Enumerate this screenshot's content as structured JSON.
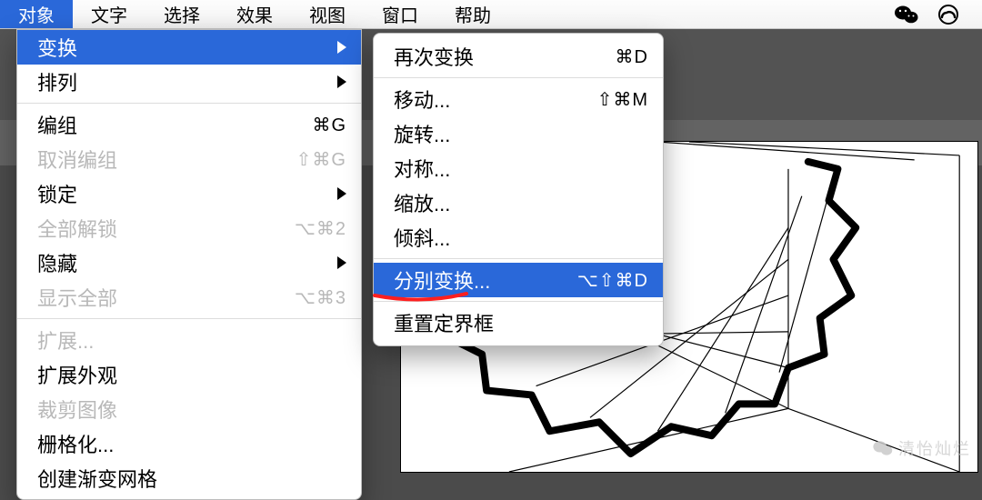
{
  "menubar": {
    "items": [
      "对象",
      "文字",
      "选择",
      "效果",
      "视图",
      "窗口",
      "帮助"
    ],
    "selected": 0
  },
  "menu1": [
    {
      "label": "变换",
      "shortcut": "",
      "arrow": true,
      "disabled": false,
      "selected": true
    },
    {
      "label": "排列",
      "shortcut": "",
      "arrow": true,
      "disabled": false
    },
    {
      "sep": true
    },
    {
      "label": "编组",
      "shortcut": "⌘G",
      "arrow": false,
      "disabled": false
    },
    {
      "label": "取消编组",
      "shortcut": "⇧⌘G",
      "arrow": false,
      "disabled": true
    },
    {
      "label": "锁定",
      "shortcut": "",
      "arrow": true,
      "disabled": false
    },
    {
      "label": "全部解锁",
      "shortcut": "⌥⌘2",
      "arrow": false,
      "disabled": true
    },
    {
      "label": "隐藏",
      "shortcut": "",
      "arrow": true,
      "disabled": false
    },
    {
      "label": "显示全部",
      "shortcut": "⌥⌘3",
      "arrow": false,
      "disabled": true
    },
    {
      "sep": true
    },
    {
      "label": "扩展...",
      "shortcut": "",
      "arrow": false,
      "disabled": true
    },
    {
      "label": "扩展外观",
      "shortcut": "",
      "arrow": false,
      "disabled": false
    },
    {
      "label": "裁剪图像",
      "shortcut": "",
      "arrow": false,
      "disabled": true
    },
    {
      "label": "栅格化...",
      "shortcut": "",
      "arrow": false,
      "disabled": false
    },
    {
      "label": "创建渐变网格",
      "shortcut": "",
      "arrow": false,
      "disabled": false
    }
  ],
  "menu2": [
    {
      "label": "再次变换",
      "shortcut": "⌘D"
    },
    {
      "sep": true
    },
    {
      "label": "移动...",
      "shortcut": "⇧⌘M"
    },
    {
      "label": "旋转..."
    },
    {
      "label": "对称..."
    },
    {
      "label": "缩放..."
    },
    {
      "label": "倾斜..."
    },
    {
      "sep": true
    },
    {
      "label": "分别变换...",
      "shortcut": "⌥⇧⌘D",
      "selected": true
    },
    {
      "sep": true
    },
    {
      "label": "重置定界框"
    }
  ],
  "watermark": "清怡灿烂"
}
